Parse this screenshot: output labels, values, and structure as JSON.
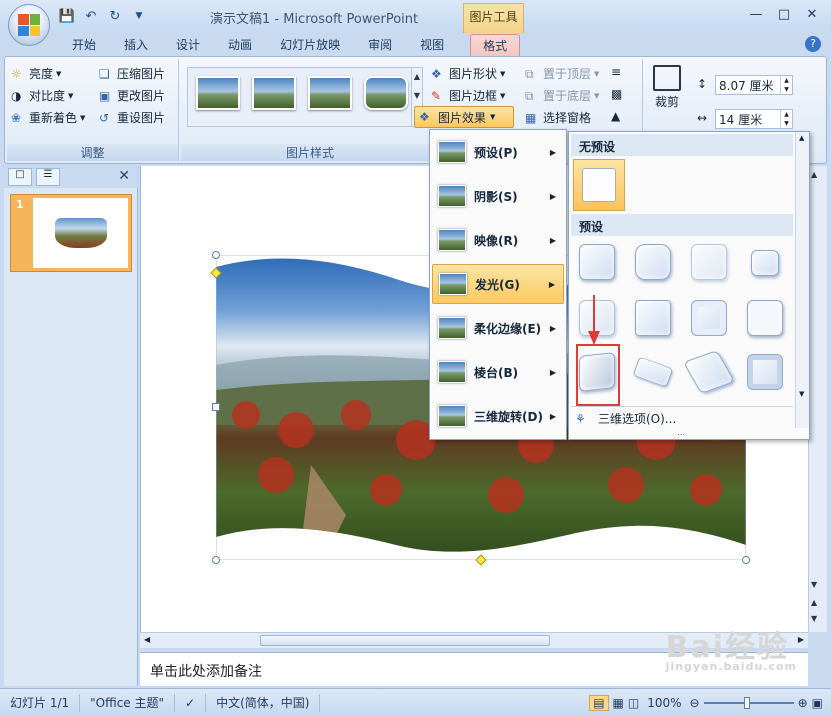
{
  "window": {
    "title": "演示文稿1 - Microsoft PowerPoint",
    "context_tab_group": "图片工具"
  },
  "tabs": [
    "开始",
    "插入",
    "设计",
    "动画",
    "幻灯片放映",
    "审阅",
    "视图",
    "格式"
  ],
  "ribbon": {
    "adjust": {
      "brightness": "亮度",
      "contrast": "对比度",
      "recolor": "重新着色",
      "compress": "压缩图片",
      "change": "更改图片",
      "reset": "重设图片",
      "label": "调整"
    },
    "styles": {
      "label": "图片样式",
      "shape": "图片形状",
      "border": "图片边框",
      "effects": "图片效果"
    },
    "arrange": {
      "bring_front": "置于顶层",
      "send_back": "置于底层",
      "selection_pane": "选择窗格"
    },
    "size": {
      "crop": "裁剪",
      "height": "8.07 厘米",
      "width": "14 厘米"
    }
  },
  "slides_pane": {
    "slide_number": "1"
  },
  "effects_menu": {
    "items": [
      "预设(P)",
      "阴影(S)",
      "映像(R)",
      "发光(G)",
      "柔化边缘(E)",
      "棱台(B)",
      "三维旋转(D)"
    ],
    "active_index": 3
  },
  "preset_gallery": {
    "no_preset_header": "无预设",
    "preset_header": "预设",
    "options_link": "三维选项(O)..."
  },
  "notes": {
    "placeholder": "单击此处添加备注"
  },
  "status": {
    "slide": "幻灯片 1/1",
    "theme": "\"Office 主题\"",
    "language": "中文(简体，中国)",
    "zoom": "100%"
  },
  "colors": {
    "accent_gold": "#fbc961",
    "context_tab": "#f3d38a",
    "highlight_red": "#e23a3a"
  },
  "watermark": {
    "brand": "Bai经验",
    "url": "jingyan.baidu.com"
  }
}
